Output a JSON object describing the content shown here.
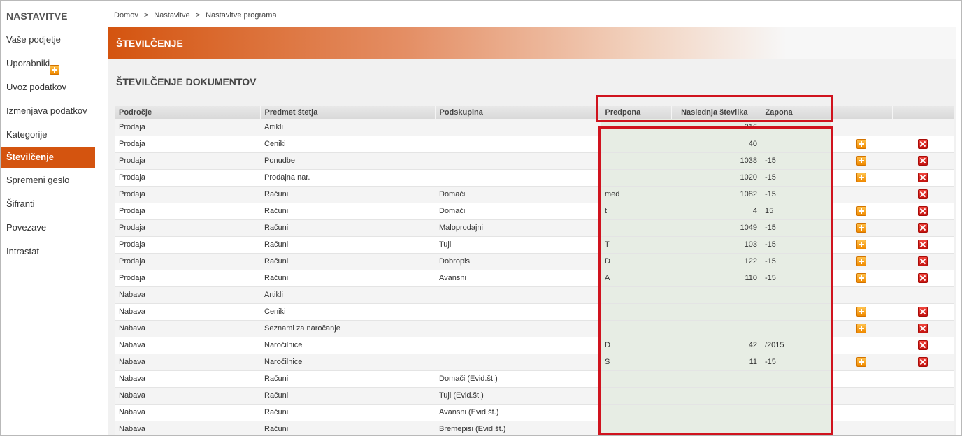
{
  "sidebar": {
    "title": "NASTAVITVE",
    "items": [
      {
        "label": "Vaše podjetje"
      },
      {
        "label": "Uporabniki"
      },
      {
        "label": "Uvoz podatkov"
      },
      {
        "label": "Izmenjava podatkov"
      },
      {
        "label": "Kategorije"
      },
      {
        "label": "Številčenje"
      },
      {
        "label": "Spremeni geslo"
      },
      {
        "label": "Šifranti"
      },
      {
        "label": "Povezave"
      },
      {
        "label": "Intrastat"
      }
    ],
    "active_index": 5
  },
  "breadcrumb": {
    "items": [
      "Domov",
      "Nastavitve",
      "Nastavitve programa"
    ],
    "separator": ">"
  },
  "banner": {
    "title": "ŠTEVILČENJE"
  },
  "section": {
    "title": "ŠTEVILČENJE DOKUMENTOV"
  },
  "table": {
    "columns": [
      "Področje",
      "Predmet štetja",
      "Podskupina",
      "Predpona",
      "Naslednja številka",
      "Zapona",
      "",
      ""
    ],
    "rows": [
      {
        "area": "Prodaja",
        "subject": "Artikli",
        "subgroup": "",
        "prefix": "",
        "next": "216",
        "suffix": "",
        "add": false,
        "del": false
      },
      {
        "area": "Prodaja",
        "subject": "Ceniki",
        "subgroup": "",
        "prefix": "",
        "next": "40",
        "suffix": "",
        "add": true,
        "del": true
      },
      {
        "area": "Prodaja",
        "subject": "Ponudbe",
        "subgroup": "",
        "prefix": "",
        "next": "1038",
        "suffix": "-15",
        "add": true,
        "del": true
      },
      {
        "area": "Prodaja",
        "subject": "Prodajna nar.",
        "subgroup": "",
        "prefix": "",
        "next": "1020",
        "suffix": "-15",
        "add": true,
        "del": true
      },
      {
        "area": "Prodaja",
        "subject": "Računi",
        "subgroup": "Domači",
        "prefix": "med",
        "next": "1082",
        "suffix": "-15",
        "add": false,
        "del": true
      },
      {
        "area": "Prodaja",
        "subject": "Računi",
        "subgroup": "Domači",
        "prefix": "t",
        "next": "4",
        "suffix": "15",
        "add": true,
        "del": true
      },
      {
        "area": "Prodaja",
        "subject": "Računi",
        "subgroup": "Maloprodajni",
        "prefix": "",
        "next": "1049",
        "suffix": "-15",
        "add": true,
        "del": true
      },
      {
        "area": "Prodaja",
        "subject": "Računi",
        "subgroup": "Tuji",
        "prefix": "T",
        "next": "103",
        "suffix": "-15",
        "add": true,
        "del": true
      },
      {
        "area": "Prodaja",
        "subject": "Računi",
        "subgroup": "Dobropis",
        "prefix": "D",
        "next": "122",
        "suffix": "-15",
        "add": true,
        "del": true
      },
      {
        "area": "Prodaja",
        "subject": "Računi",
        "subgroup": "Avansni",
        "prefix": "A",
        "next": "110",
        "suffix": "-15",
        "add": true,
        "del": true
      },
      {
        "area": "Nabava",
        "subject": "Artikli",
        "subgroup": "",
        "prefix": "",
        "next": "",
        "suffix": "",
        "add": false,
        "del": false
      },
      {
        "area": "Nabava",
        "subject": "Ceniki",
        "subgroup": "",
        "prefix": "",
        "next": "",
        "suffix": "",
        "add": true,
        "del": true
      },
      {
        "area": "Nabava",
        "subject": "Seznami za naročanje",
        "subgroup": "",
        "prefix": "",
        "next": "",
        "suffix": "",
        "add": true,
        "del": true
      },
      {
        "area": "Nabava",
        "subject": "Naročilnice",
        "subgroup": "",
        "prefix": "D",
        "next": "42",
        "suffix": "/2015",
        "add": false,
        "del": true
      },
      {
        "area": "Nabava",
        "subject": "Naročilnice",
        "subgroup": "",
        "prefix": "S",
        "next": "11",
        "suffix": "-15",
        "add": true,
        "del": true
      },
      {
        "area": "Nabava",
        "subject": "Računi",
        "subgroup": "Domači (Evid.št.)",
        "prefix": "",
        "next": "",
        "suffix": "",
        "add": false,
        "del": false
      },
      {
        "area": "Nabava",
        "subject": "Računi",
        "subgroup": "Tuji (Evid.št.)",
        "prefix": "",
        "next": "",
        "suffix": "",
        "add": false,
        "del": false
      },
      {
        "area": "Nabava",
        "subject": "Računi",
        "subgroup": "Avansni (Evid.št.)",
        "prefix": "",
        "next": "",
        "suffix": "",
        "add": false,
        "del": false
      },
      {
        "area": "Nabava",
        "subject": "Računi",
        "subgroup": "Bremepisi (Evid.št.)",
        "prefix": "",
        "next": "",
        "suffix": "",
        "add": false,
        "del": false
      }
    ]
  },
  "colors": {
    "accent": "#d4540f",
    "highlight": "#d0131e",
    "editable_bg": "#e7ede4"
  },
  "icons": {
    "add": "add-icon",
    "delete": "delete-icon"
  }
}
